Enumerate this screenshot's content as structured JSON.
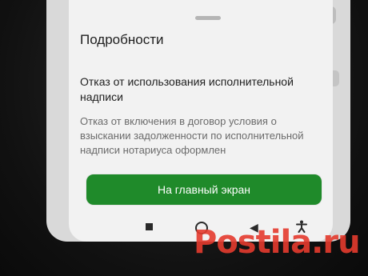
{
  "sheet": {
    "title": "Подробности",
    "heading": "Отказ от использования исполнительной надписи",
    "body": "Отказ от включения в договор условия о взыскании задолженности по исполнительной надписи нотариуса оформлен"
  },
  "actions": {
    "home_button_label": "На главный экран"
  },
  "navigation": {
    "buttons": [
      "recents-icon",
      "home-icon",
      "back-icon",
      "accessibility-icon"
    ]
  },
  "watermark": {
    "text": "Postila.ru"
  },
  "colors": {
    "accent_green": "#1f8a2a",
    "sheet_background": "#f2f2f2",
    "watermark_red": "#e53b2e"
  }
}
